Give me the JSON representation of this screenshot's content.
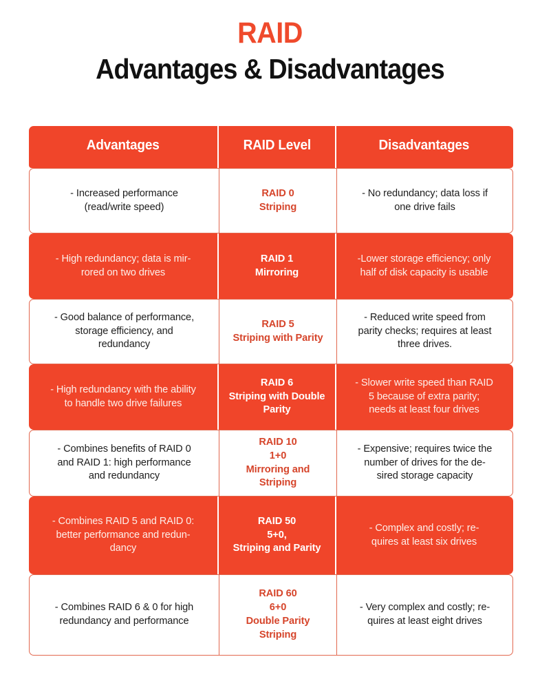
{
  "title": {
    "main": "RAID",
    "sub": "Advantages & Disadvantages",
    "main_color": "#ef4a2c",
    "sub_color": "#111111"
  },
  "theme": {
    "accent": "#f0452a",
    "accent_text_on_white": "#d6452b",
    "border": "#e2674e",
    "text_on_orange": "#fdeee9",
    "text_on_white": "#1d1d1d"
  },
  "table": {
    "headers": {
      "advantages": "Advantages",
      "level": "RAID Level",
      "disadvantages": "Disadvantages"
    },
    "rows": [
      {
        "advantages": "- Increased performance\n(read/write speed)",
        "level": "RAID 0\nStriping",
        "disadvantages": "- No redundancy; data loss if\none drive fails",
        "style": "white"
      },
      {
        "advantages": "- High redundancy; data is mir-\nrored on two drives",
        "level": "RAID 1\nMirroring",
        "disadvantages": "-Lower storage efficiency; only\nhalf of disk capacity is usable",
        "style": "orange"
      },
      {
        "advantages": "- Good balance of performance,\nstorage efficiency, and\nredundancy",
        "level": "RAID 5\nStriping with Parity",
        "disadvantages": "- Reduced write speed from\nparity checks; requires at least\nthree drives.",
        "style": "white"
      },
      {
        "advantages": "- High redundancy with the ability\nto handle two drive failures",
        "level": "RAID 6\nStriping with Double\nParity",
        "disadvantages": "- Slower write speed than RAID\n5 because of extra parity;\nneeds at least four drives",
        "style": "orange"
      },
      {
        "advantages": "- Combines benefits of RAID 0\nand RAID 1: high performance\nand redundancy",
        "level": "RAID 10\n1+0\nMirroring and Striping",
        "disadvantages": "- Expensive; requires twice the\nnumber of drives for the de-\nsired storage capacity",
        "style": "white"
      },
      {
        "advantages": "- Combines RAID 5 and RAID 0:\nbetter performance and redun-\ndancy",
        "level": "RAID 50\n5+0,\nStriping and Parity",
        "disadvantages": "- Complex and costly; re-\nquires at least six drives",
        "style": "orange"
      },
      {
        "advantages": "- Combines RAID 6 & 0 for high\nredundancy and performance",
        "level": "RAID 60\n6+0\nDouble Parity Striping",
        "disadvantages": "- Very complex and costly; re-\nquires at least eight drives",
        "style": "white"
      }
    ]
  }
}
